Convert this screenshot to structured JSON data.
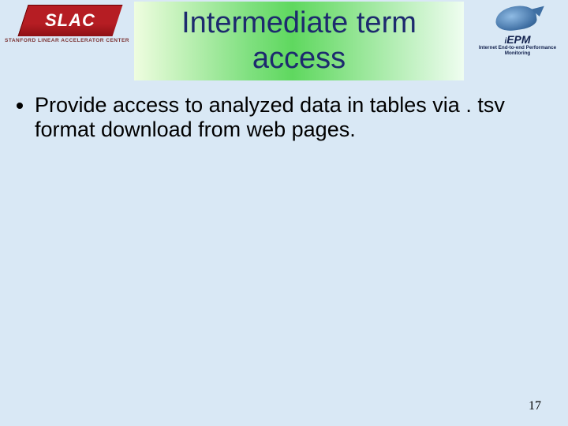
{
  "header": {
    "logo_left": {
      "mark_text": "SLAC",
      "strap": "STANFORD LINEAR ACCELERATOR CENTER"
    },
    "title": "Intermediate term access",
    "logo_right": {
      "brand_prefix": "i",
      "brand_main": "EPM",
      "sub": "Internet End-to-end Performance Monitoring"
    }
  },
  "body": {
    "bullets": [
      "Provide access to analyzed data in tables via . tsv format download from web pages."
    ]
  },
  "page_number": "17"
}
